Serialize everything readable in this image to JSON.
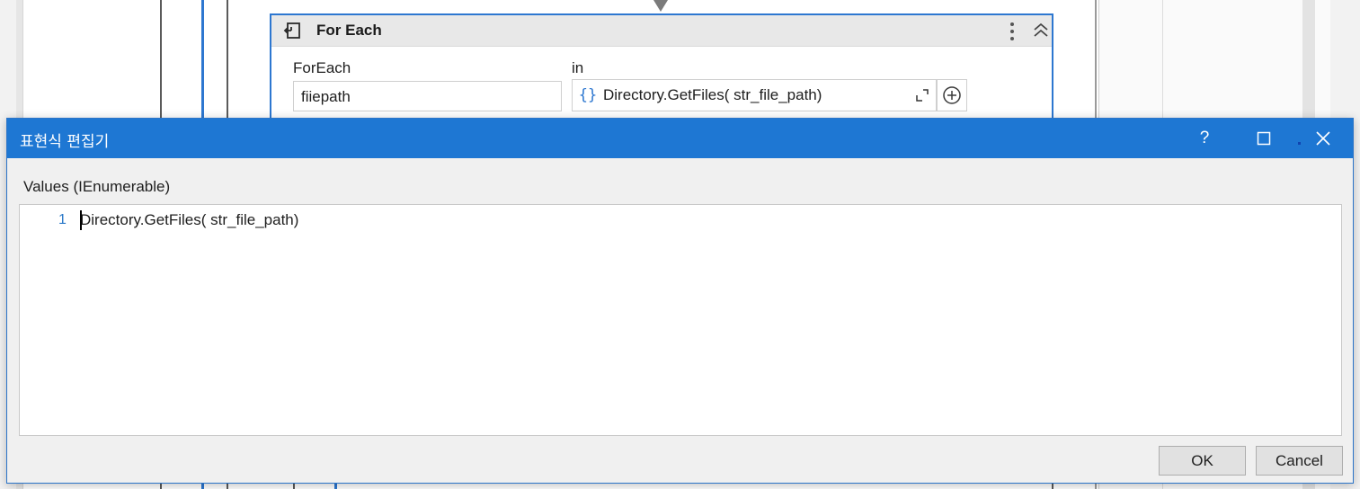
{
  "activity": {
    "title": "For Each",
    "foreach_label": "ForEach",
    "foreach_value": "fiiepath",
    "in_label": "in",
    "in_braces": "{}",
    "in_value": "Directory.GetFiles( str_file_path)",
    "icons": {
      "activity": "for-each-activity-icon",
      "menu": "more-vertical-icon",
      "collapse": "double-chevron-up-icon",
      "expand": "expand-corner-icon",
      "add": "add-circle-icon"
    }
  },
  "dialog": {
    "title": "표현식 편집기",
    "help": "?",
    "value_type_label": "Values (IEnumerable)",
    "editor": {
      "lines": [
        {
          "number": "1",
          "text": "Directory.GetFiles( str_file_path)"
        }
      ]
    },
    "ok_label": "OK",
    "cancel_label": "Cancel",
    "icons": {
      "maximize": "maximize-icon",
      "close": "close-icon"
    }
  },
  "colors": {
    "accent": "#1e77d3",
    "activity_border": "#2d77d0",
    "line_number": "#2b79c8"
  }
}
